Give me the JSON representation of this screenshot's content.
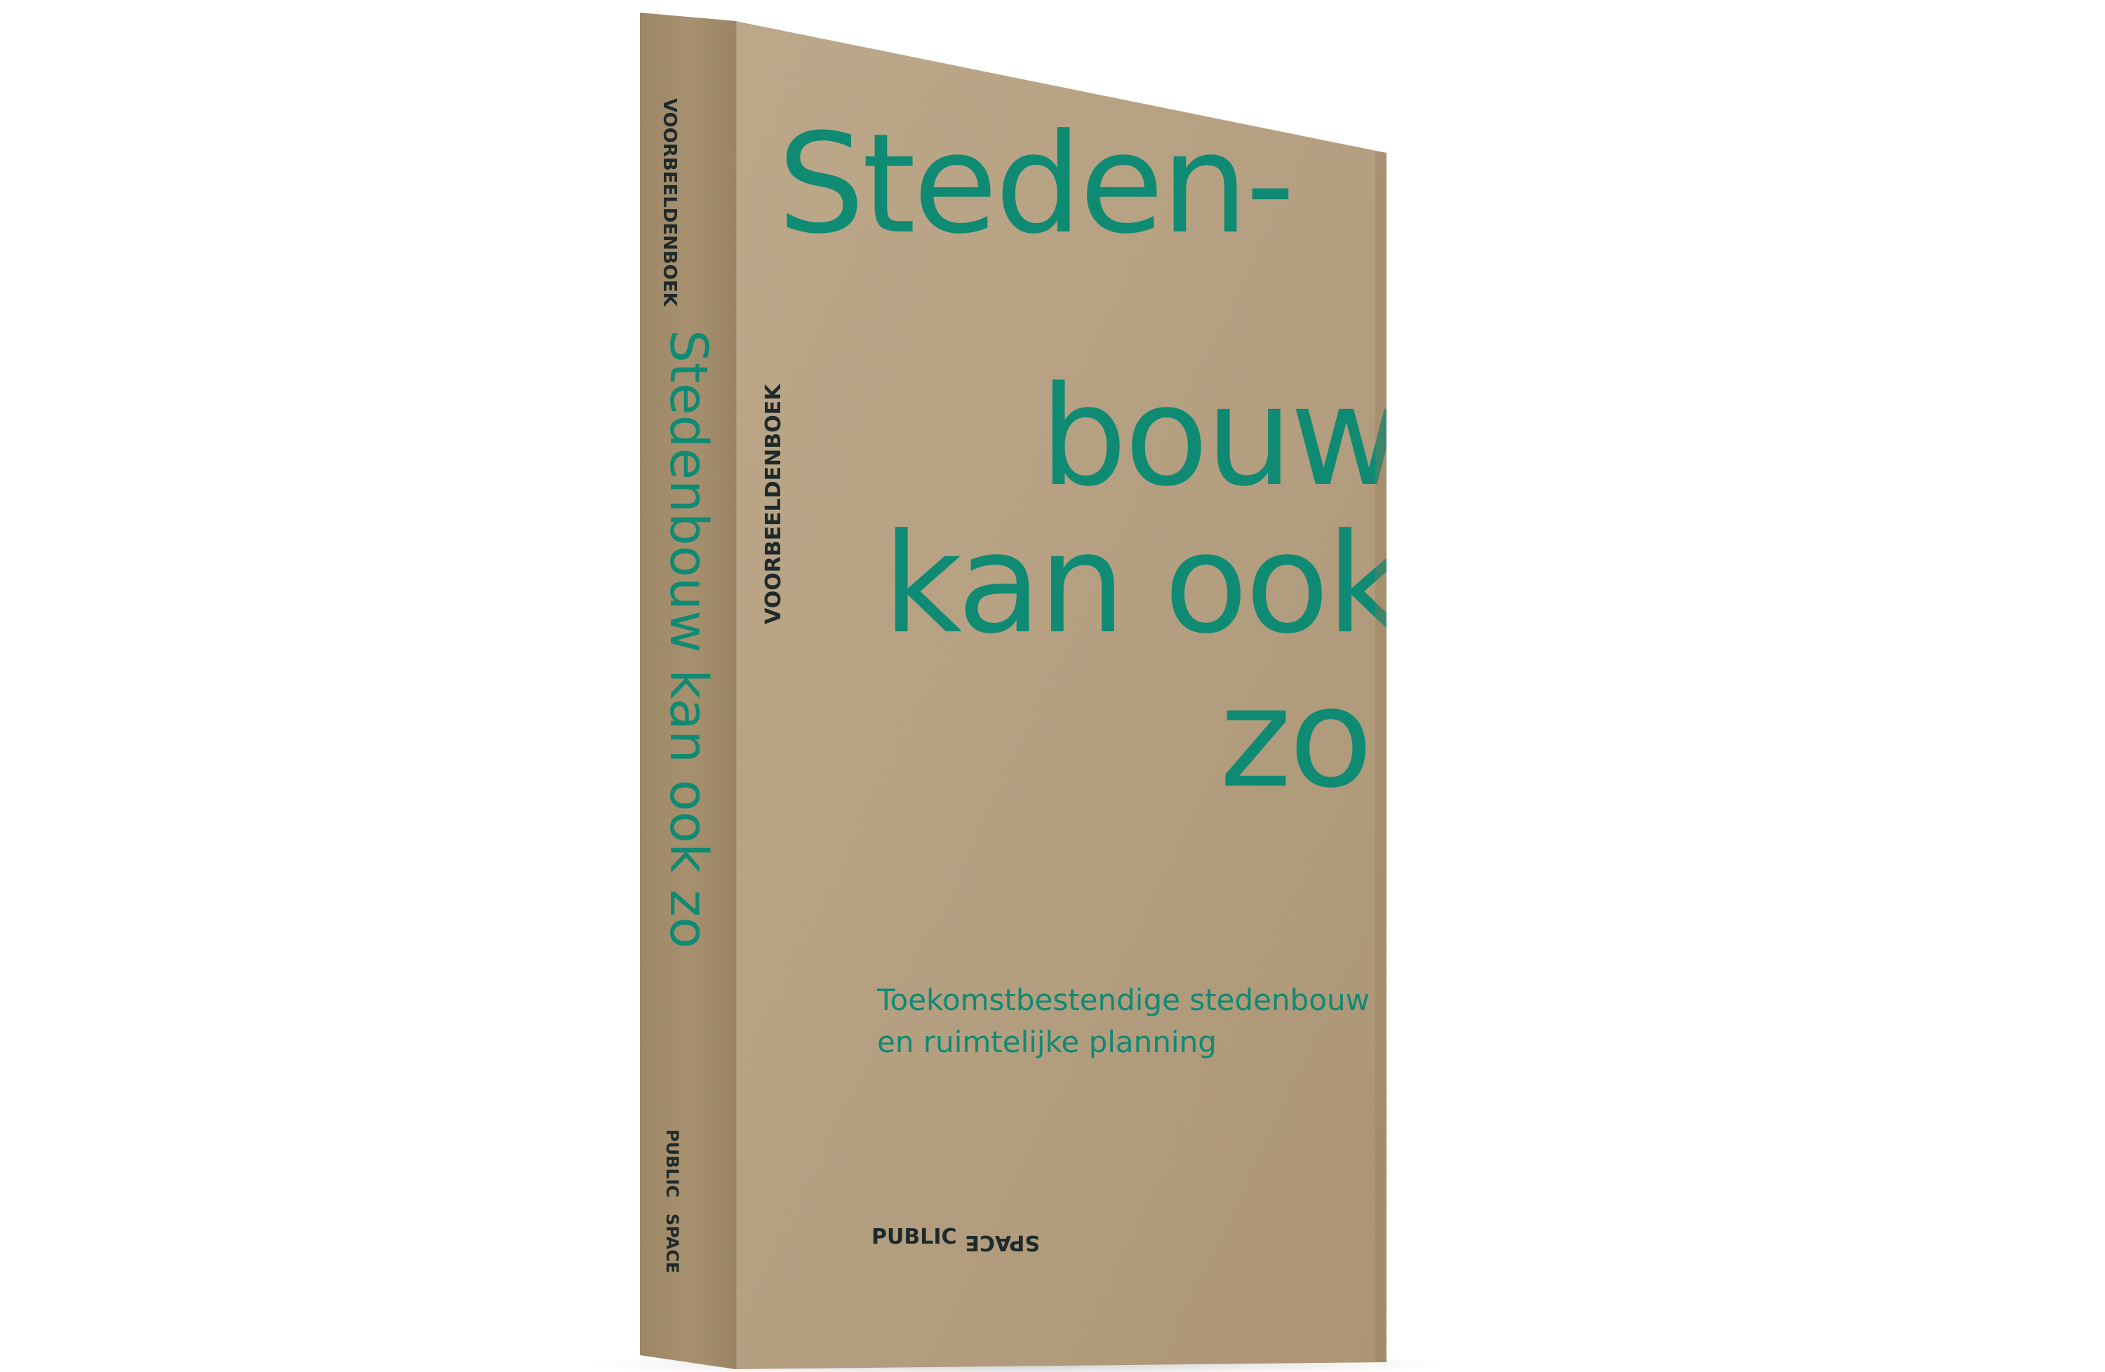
{
  "colors": {
    "kraft": "#b8a283",
    "kraft_dark": "#a8916f",
    "spine": "#a58e6b",
    "ink": "#0f8a73",
    "ink_dark": "#1e2a2a"
  },
  "cover": {
    "series_label": "VOORBEELDENBOEK",
    "title_lines": [
      "Steden-",
      "bouw",
      "kan ook",
      "zo"
    ],
    "subtitle_lines": [
      "Toekomstbestendige stedenbouw",
      "en ruimtelijke planning"
    ],
    "publisher_left": "PUBLIC",
    "publisher_right": "SPACE"
  },
  "spine": {
    "series_label": "VOORBEELDENBOEK",
    "title": "Stedenbouw kan ook zo",
    "publisher_top": "PUBLIC",
    "publisher_bottom": "SPACE"
  }
}
